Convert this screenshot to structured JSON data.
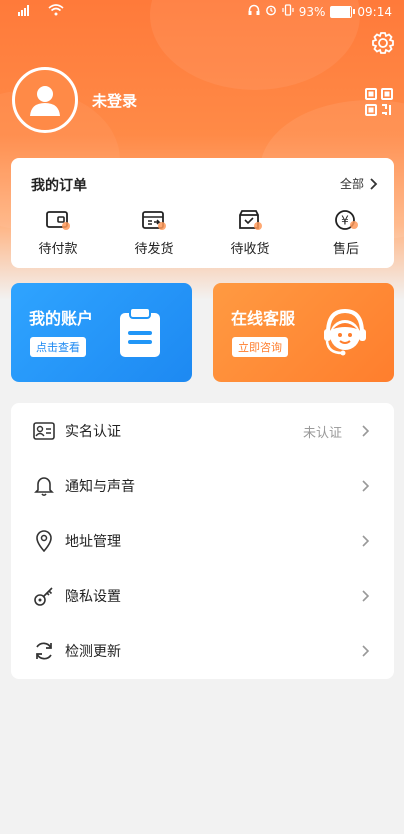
{
  "status_bar": {
    "signal": "ᵘ\"ıll",
    "battery_percent": "93%",
    "time": "09:14",
    "battery_level": 0.93
  },
  "profile": {
    "login_status": "未登录"
  },
  "orders": {
    "title": "我的订单",
    "all_label": "全部",
    "items": [
      {
        "label": "待付款",
        "icon": "wallet-icon"
      },
      {
        "label": "待发货",
        "icon": "package-icon"
      },
      {
        "label": "待收货",
        "icon": "box-receive-icon"
      },
      {
        "label": "售后",
        "icon": "yuan-service-icon"
      }
    ]
  },
  "cards": {
    "account": {
      "title": "我的账户",
      "button": "点击查看",
      "color": "#1d89f2"
    },
    "service": {
      "title": "在线客服",
      "button": "立即咨询",
      "color": "#ff7e2d"
    }
  },
  "menu": {
    "items": [
      {
        "label": "实名认证",
        "status": "未认证",
        "icon": "id-card-icon"
      },
      {
        "label": "通知与声音",
        "status": "",
        "icon": "bell-icon"
      },
      {
        "label": "地址管理",
        "status": "",
        "icon": "location-pin-icon"
      },
      {
        "label": "隐私设置",
        "status": "",
        "icon": "key-icon"
      },
      {
        "label": "检测更新",
        "status": "",
        "icon": "refresh-icon"
      }
    ]
  },
  "colors": {
    "accent": "#ff7a3a",
    "background": "#f2f2f2"
  }
}
